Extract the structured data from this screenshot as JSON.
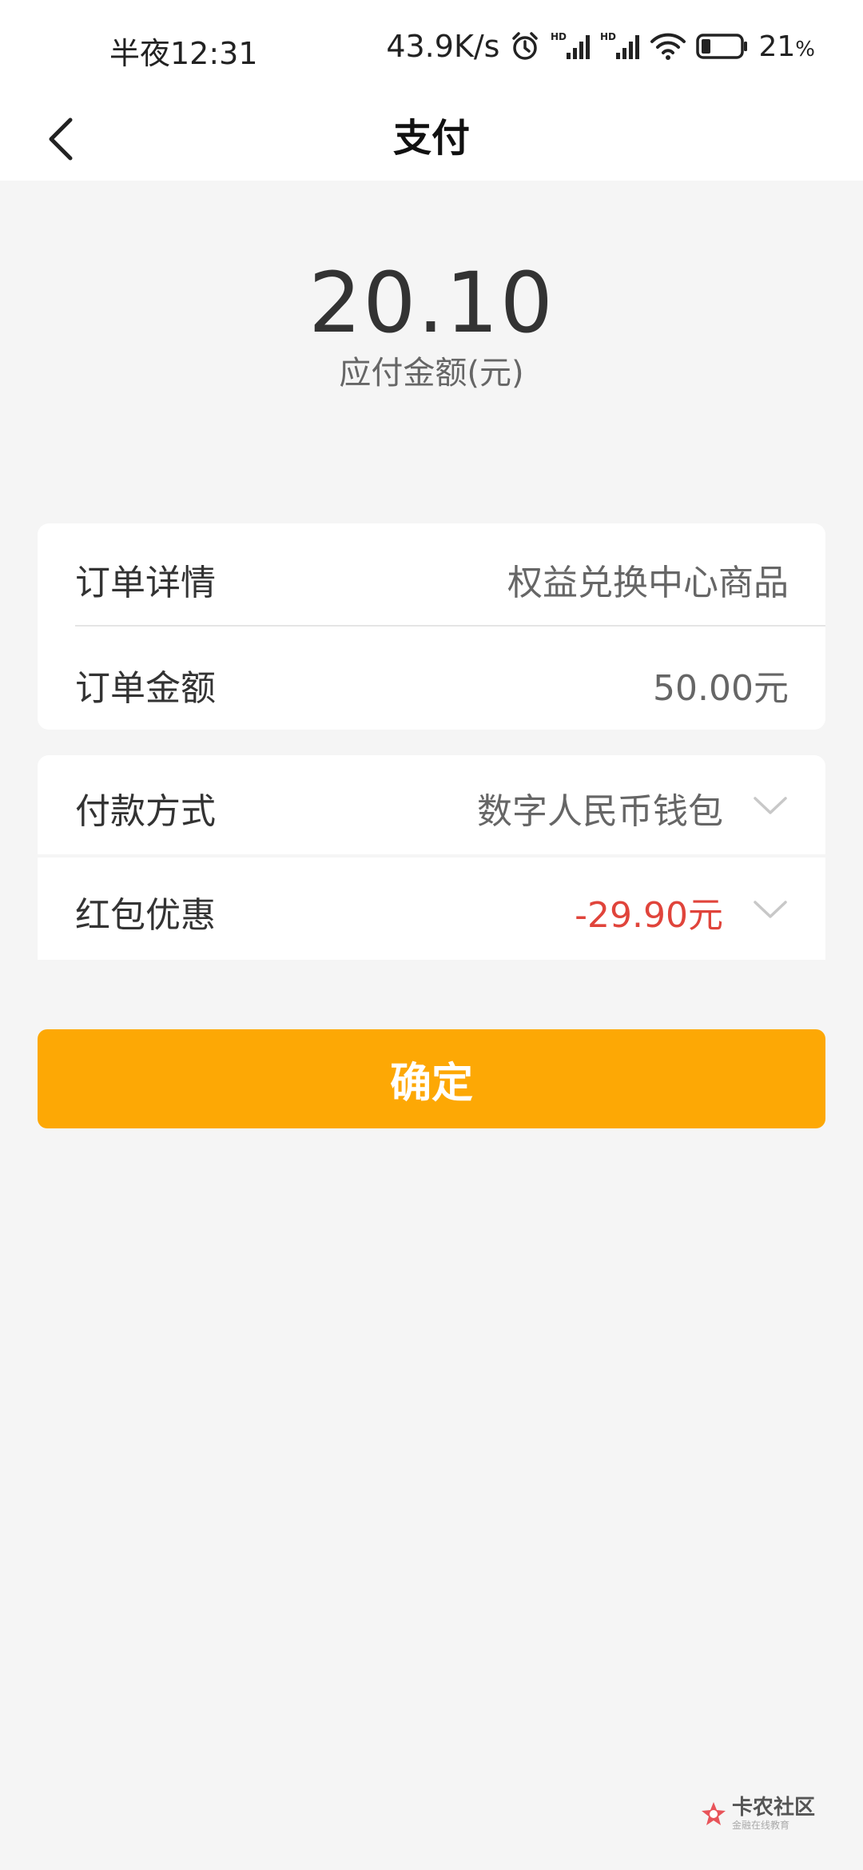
{
  "status_bar": {
    "time": "半夜12:31",
    "network_speed": "43.9K/s",
    "battery_percent": "21",
    "battery_unit": "%",
    "icons": [
      "alarm-icon",
      "hd-signal-icon",
      "hd-signal-icon",
      "wifi-icon",
      "battery-icon"
    ]
  },
  "header": {
    "title": "支付",
    "back_icon": "chevron-left-icon"
  },
  "amount": {
    "value": "20.10",
    "label": "应付金额(元)"
  },
  "order": {
    "detail_label": "订单详情",
    "detail_value": "权益兑换中心商品",
    "amount_label": "订单金额",
    "amount_value": "50.00元"
  },
  "payment": {
    "method_label": "付款方式",
    "method_value": "数字人民币钱包",
    "discount_label": "红包优惠",
    "discount_value": "-29.90元"
  },
  "confirm_label": "确定",
  "watermark": {
    "title": "卡农社区",
    "subtitle": "金融在线教育"
  },
  "colors": {
    "accent": "#fda805",
    "discount": "#e0443b",
    "background": "#f5f5f5"
  }
}
